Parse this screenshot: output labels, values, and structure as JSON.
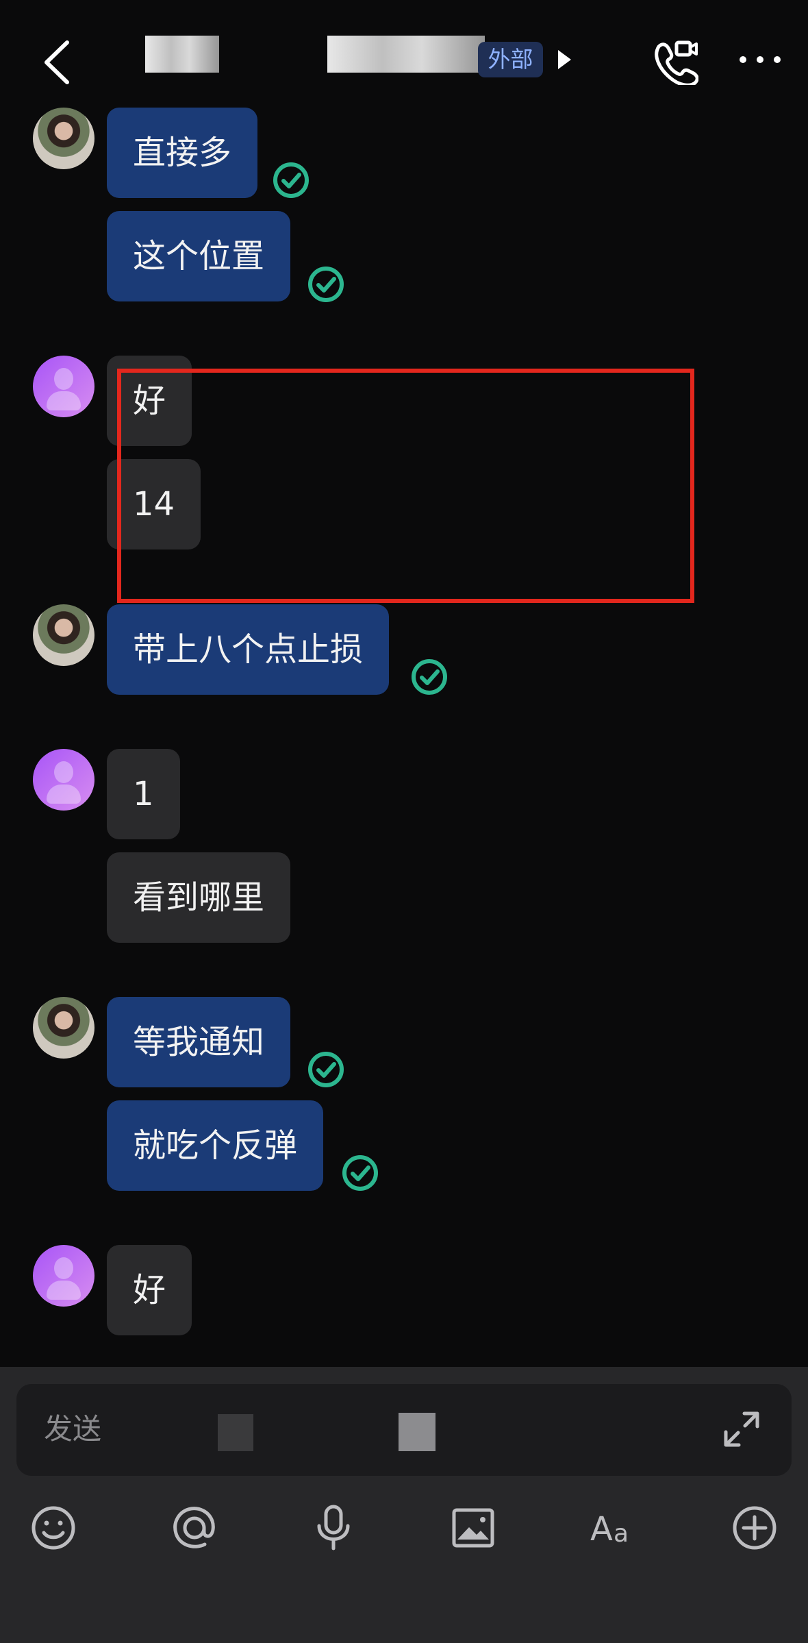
{
  "header": {
    "tag": "外部"
  },
  "messages": [
    {
      "text": "直接多"
    },
    {
      "text": "这个位置"
    },
    {
      "text": "好"
    },
    {
      "text": "14"
    },
    {
      "text": "带上八个点止损"
    },
    {
      "text": "1"
    },
    {
      "text": "看到哪里"
    },
    {
      "text": "等我通知"
    },
    {
      "text": "就吃个反弹"
    },
    {
      "text": "好"
    }
  ],
  "composer": {
    "placeholder": "发送"
  },
  "icons": {
    "back": "chevron-left-icon",
    "call": "phone-video-icon",
    "more": "more-icon",
    "read": "check-circle-icon",
    "emoji": "emoji-icon",
    "mention": "at-icon",
    "voice": "microphone-icon",
    "image": "image-icon",
    "format": "text-format-icon",
    "add": "plus-circle-icon",
    "expand": "expand-icon"
  },
  "colors": {
    "background": "#0a0a0b",
    "sent_bubble": "#1b3b77",
    "received_bubble": "#2a2a2c",
    "read_check": "#2cb68f",
    "annotation": "#e3271d",
    "external_tag": "#8fb2ff"
  }
}
